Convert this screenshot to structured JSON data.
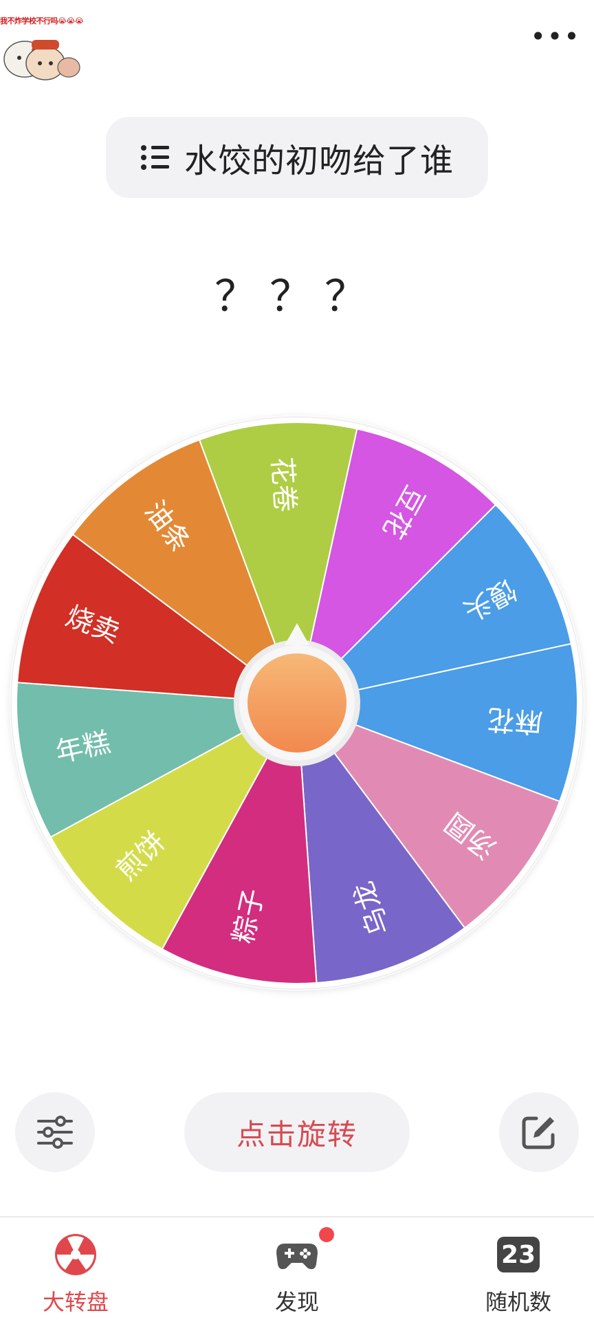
{
  "sticker": {
    "caption": "我不炸学校不行吗😭😭😭"
  },
  "header": {
    "more_label": "•••"
  },
  "title": {
    "text": "水饺的初吻给了谁"
  },
  "result": {
    "text": "？？？"
  },
  "wheel": {
    "segments": [
      {
        "label": "花卷",
        "color": "#aecd44"
      },
      {
        "label": "豆花",
        "color": "#d456e2"
      },
      {
        "label": "馒头",
        "color": "#4a9de6"
      },
      {
        "label": "麻花",
        "color": "#4a9de6"
      },
      {
        "label": "汤圆",
        "color": "#e18bb4"
      },
      {
        "label": "乌龙",
        "color": "#7866c9"
      },
      {
        "label": "粽子",
        "color": "#d32d7f"
      },
      {
        "label": "煎饼",
        "color": "#d3dc48"
      },
      {
        "label": "年糕",
        "color": "#72bdab"
      },
      {
        "label": "烧卖",
        "color": "#d22f26"
      },
      {
        "label": "油条",
        "color": "#e38935"
      }
    ],
    "hub_gradient": [
      "#f6b877",
      "#f2894e"
    ]
  },
  "controls": {
    "spin_label": "点击旋转",
    "settings_icon": "sliders-icon",
    "edit_icon": "edit-icon"
  },
  "tabs": [
    {
      "label": "大转盘",
      "icon": "wheel-icon",
      "active": true
    },
    {
      "label": "发现",
      "icon": "gamepad-icon",
      "active": false
    },
    {
      "label": "随机数",
      "icon": "number-icon",
      "value": "23",
      "active": false
    }
  ],
  "colors": {
    "accent": "#e0474c",
    "pill_bg": "#f2f2f5"
  }
}
